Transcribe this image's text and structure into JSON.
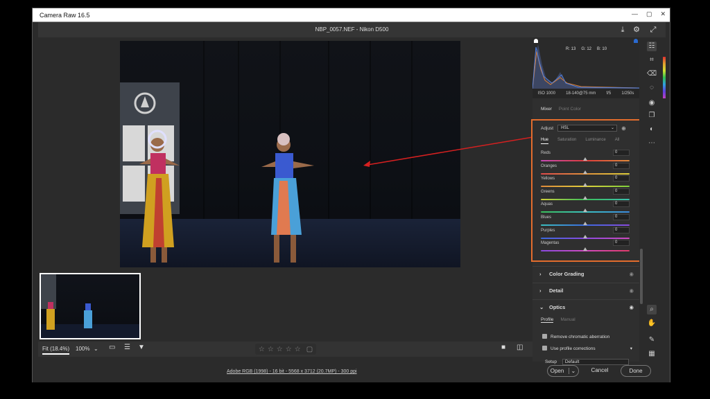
{
  "window": {
    "title": "Camera Raw 16.5",
    "min": "—",
    "max": "▢",
    "close": "✕"
  },
  "header": {
    "filename": "NBP_0057.NEF  -  Nikon D500"
  },
  "histogram": {
    "r": "R: 13",
    "g": "G: 12",
    "b": "B: 10"
  },
  "camera": {
    "iso": "ISO 1000",
    "lens": "18-140@75 mm",
    "aperture": "f/5",
    "shutter": "1/250s"
  },
  "mixer": {
    "tabs": [
      "Mixer",
      "Point Color"
    ],
    "adjust_label": "Adjust",
    "adjust_value": "HSL",
    "hsl_tabs": [
      "Hue",
      "Saturation",
      "Luminance",
      "All"
    ],
    "sliders": [
      {
        "label": "Reds",
        "value": "0",
        "position": 0.5,
        "gradient": "linear-gradient(90deg,#c64bb5,#e03b3b,#e08a3b)"
      },
      {
        "label": "Oranges",
        "value": "0",
        "position": 0.5,
        "gradient": "linear-gradient(90deg,#e04a4a,#e0913b,#e0d03b)"
      },
      {
        "label": "Yellows",
        "value": "0",
        "position": 0.5,
        "gradient": "linear-gradient(90deg,#e08a3b,#e0d03b,#7ed03b)"
      },
      {
        "label": "Greens",
        "value": "0",
        "position": 0.5,
        "gradient": "linear-gradient(90deg,#d0d03b,#3bc05a,#3bc0b0)"
      },
      {
        "label": "Aquas",
        "value": "0",
        "position": 0.5,
        "gradient": "linear-gradient(90deg,#3bc05a,#3bc0c0,#3b8ae0)"
      },
      {
        "label": "Blues",
        "value": "0",
        "position": 0.5,
        "gradient": "linear-gradient(90deg,#3bc0c0,#3b6ae0,#8a4ae0)"
      },
      {
        "label": "Purples",
        "value": "0",
        "position": 0.5,
        "gradient": "linear-gradient(90deg,#3b6ae0,#8a4ae0,#d04ac0)"
      },
      {
        "label": "Magentas",
        "value": "0",
        "position": 0.5,
        "gradient": "linear-gradient(90deg,#8a4ae0,#d04ac0,#e03b6a)"
      }
    ]
  },
  "sections": {
    "color_grading": "Color Grading",
    "detail": "Detail",
    "optics": "Optics"
  },
  "optics": {
    "tabs": [
      "Profile",
      "Manual"
    ],
    "remove_ca": "Remove chromatic aberration",
    "use_profile": "Use profile corrections",
    "setup_label": "Setup",
    "setup_value": "Default"
  },
  "toolbar": {
    "fit": "Fit (18.4%)",
    "zoom": "100%",
    "stars": [
      "☆",
      "☆",
      "☆",
      "☆",
      "☆"
    ]
  },
  "status": {
    "workflow": "Adobe RGB (1998) - 16 bit - 5568 x 3712 (20.7MP) - 300 ppi",
    "open": "Open",
    "cancel": "Cancel",
    "done": "Done"
  },
  "colors": {
    "highlight": "#e46d2d",
    "annotation_arrow": "#d62020"
  }
}
